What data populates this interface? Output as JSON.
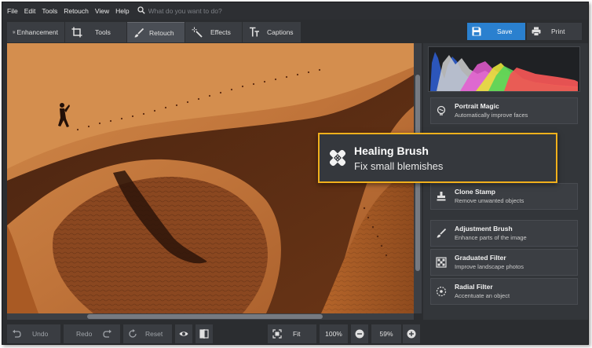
{
  "menu": {
    "items": [
      "File",
      "Edit",
      "Tools",
      "Retouch",
      "View",
      "Help"
    ],
    "search_placeholder": "What do you want to do?"
  },
  "toolbar": {
    "tabs": [
      {
        "label": "Enhancement",
        "icon": "sliders-icon"
      },
      {
        "label": "Tools",
        "icon": "crop-icon"
      },
      {
        "label": "Retouch",
        "icon": "brush-icon",
        "active": true
      },
      {
        "label": "Effects",
        "icon": "magic-wand-icon"
      },
      {
        "label": "Captions",
        "icon": "text-icon"
      }
    ],
    "save_label": "Save",
    "print_label": "Print"
  },
  "retouch_tools": [
    {
      "title": "Portrait Magic",
      "desc": "Automatically improve faces",
      "icon": "portrait-icon"
    },
    {
      "title": "Clone Stamp",
      "desc": "Remove unwanted objects",
      "icon": "stamp-icon"
    },
    {
      "title": "Adjustment Brush",
      "desc": "Enhance parts of the image",
      "icon": "brush-icon"
    },
    {
      "title": "Graduated Filter",
      "desc": "Improve landscape photos",
      "icon": "gradient-icon"
    },
    {
      "title": "Radial Filter",
      "desc": "Accentuate an object",
      "icon": "radial-icon"
    }
  ],
  "callout": {
    "title": "Healing Brush",
    "desc": "Fix small blemishes",
    "icon": "bandage-icon"
  },
  "bottom": {
    "undo_label": "Undo",
    "redo_label": "Redo",
    "reset_label": "Reset",
    "fit_label": "Fit",
    "zoom_100": "100%",
    "zoom_value": "59%"
  },
  "colors": {
    "accent": "#2a80cf",
    "highlight": "#f1b01c",
    "panel": "#33363a"
  }
}
